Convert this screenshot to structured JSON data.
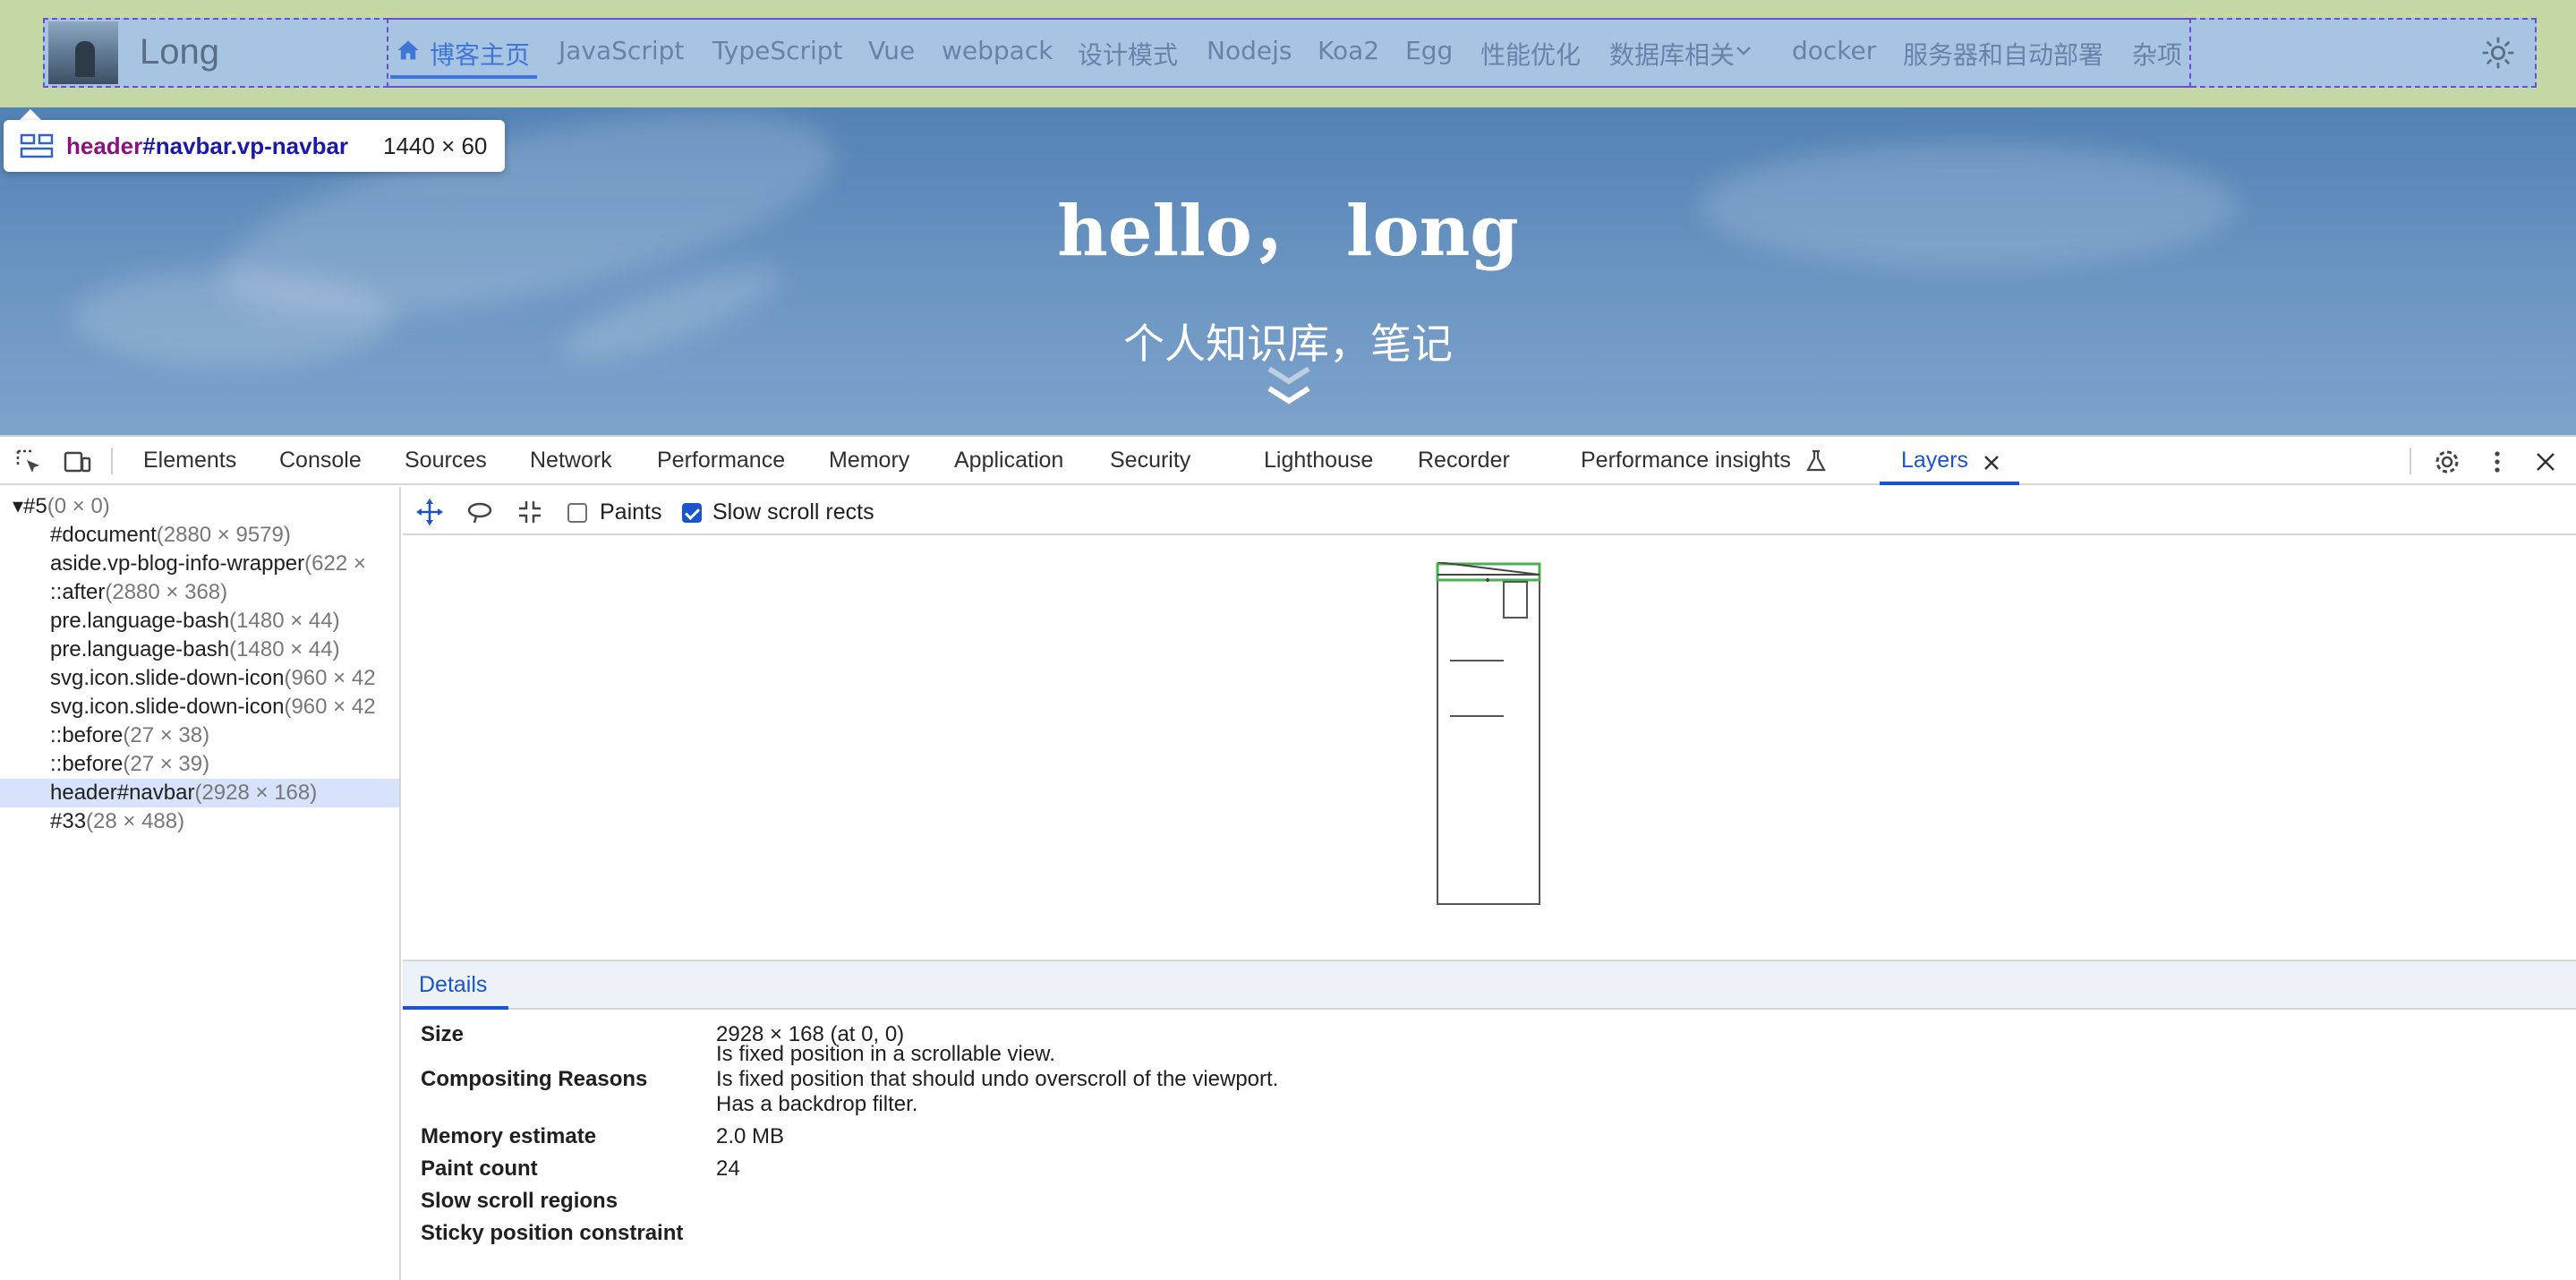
{
  "site": {
    "logo_text": "Long",
    "nav_items": [
      "博客主页",
      "JavaScript",
      "TypeScript",
      "Vue",
      "webpack",
      "设计模式",
      "Nodejs",
      "Koa2",
      "Egg",
      "性能优化",
      "数据库相关",
      "docker",
      "服务器和自动部署",
      "杂项"
    ],
    "hero_title": "hello， long",
    "hero_subtitle": "个人知识库，笔记",
    "accent_color": "#3f76d6",
    "theme_toggle_icon": "sun-icon"
  },
  "inspect_tooltip": {
    "tag": "header",
    "id": "#navbar",
    "classes": ".vp-navbar",
    "dims": "1440 × 60"
  },
  "devtools": {
    "tabs": [
      "Elements",
      "Console",
      "Sources",
      "Network",
      "Performance",
      "Memory",
      "Application",
      "Security",
      "Lighthouse",
      "Recorder",
      "Performance insights",
      "Layers"
    ],
    "active_tab": "Layers",
    "toolbar": {
      "paints_label": "Paints",
      "paints_checked": false,
      "slow_scroll_label": "Slow scroll rects",
      "slow_scroll_checked": true
    },
    "layer_tree": [
      {
        "name": "#5",
        "dims": "(0 × 0)",
        "root": true
      },
      {
        "name": "#document",
        "dims": "(2880 × 9579)"
      },
      {
        "name": "aside.vp-blog-info-wrapper",
        "dims": "(622 ×"
      },
      {
        "name": "::after",
        "dims": "(2880 × 368)"
      },
      {
        "name": "pre.language-bash",
        "dims": "(1480 × 44)"
      },
      {
        "name": "pre.language-bash",
        "dims": "(1480 × 44)"
      },
      {
        "name": "svg.icon.slide-down-icon",
        "dims": "(960 × 42"
      },
      {
        "name": "svg.icon.slide-down-icon",
        "dims": "(960 × 42"
      },
      {
        "name": "::before",
        "dims": "(27 × 38)"
      },
      {
        "name": "::before",
        "dims": "(27 × 39)"
      },
      {
        "name": "header#navbar",
        "dims": "(2928 × 168)",
        "selected": true
      },
      {
        "name": "#33",
        "dims": "(28 × 488)"
      }
    ],
    "details_tab": "Details",
    "details": {
      "size_label": "Size",
      "size_value": "2928 × 168 (at 0, 0)",
      "compositing_label": "Compositing Reasons",
      "compositing_values": [
        "Is fixed position in a scrollable view.",
        "Is fixed position that should undo overscroll of the viewport.",
        "Has a backdrop filter."
      ],
      "memory_label": "Memory estimate",
      "memory_value": "2.0 MB",
      "paint_label": "Paint count",
      "paint_value": "24",
      "slow_scroll_label": "Slow scroll regions",
      "sticky_label": "Sticky position constraint"
    }
  }
}
